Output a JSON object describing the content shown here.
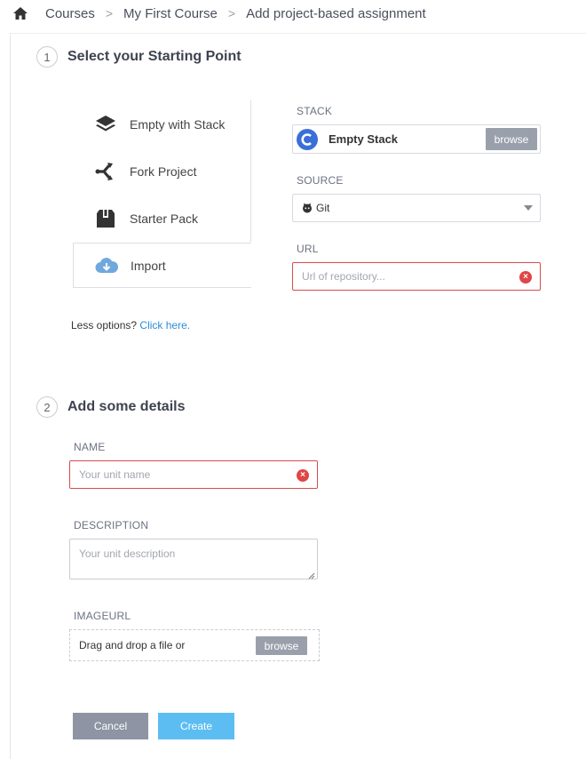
{
  "breadcrumb": {
    "home_icon": "home-icon",
    "items": [
      "Courses",
      "My First Course",
      "Add project-based assignment"
    ],
    "separator": ">"
  },
  "step1": {
    "number": "1",
    "title": "Select your Starting Point"
  },
  "options": [
    {
      "label": "Empty with Stack",
      "icon": "layers-icon"
    },
    {
      "label": "Fork Project",
      "icon": "fork-icon"
    },
    {
      "label": "Starter Pack",
      "icon": "box-icon"
    },
    {
      "label": "Import",
      "icon": "cloud-download-icon"
    }
  ],
  "stack": {
    "label": "STACK",
    "value": "Empty Stack",
    "browse": "browse"
  },
  "source": {
    "label": "SOURCE",
    "value": "Git"
  },
  "url": {
    "label": "URL",
    "placeholder": "Url of repository..."
  },
  "less_options": {
    "text": "Less options?",
    "link": "Click here."
  },
  "step2": {
    "number": "2",
    "title": "Add some details"
  },
  "name": {
    "label": "NAME",
    "placeholder": "Your unit name"
  },
  "description": {
    "label": "DESCRIPTION",
    "placeholder": "Your unit description"
  },
  "imageurl": {
    "label": "IMAGEURL",
    "text": "Drag and drop a file or",
    "browse": "browse"
  },
  "actions": {
    "cancel": "Cancel",
    "create": "Create"
  },
  "colors": {
    "error": "#e04646",
    "link": "#2d8cd6",
    "create": "#5cbdf3",
    "cancel": "#8e94a3"
  }
}
